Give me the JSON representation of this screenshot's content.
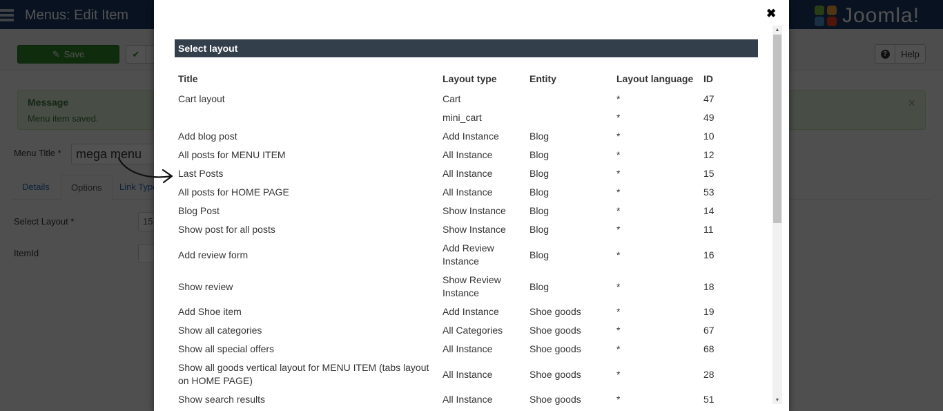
{
  "app": {
    "page_title": "Menus: Edit Item",
    "brand": "Joomla!"
  },
  "toolbar": {
    "save_label": "Save",
    "help_label": "Help"
  },
  "alert": {
    "heading": "Message",
    "message": "Menu item saved.",
    "close_glyph": "×"
  },
  "form": {
    "menu_title_label": "Menu Title *",
    "menu_title_value": "mega menu",
    "tabs": [
      {
        "label": "Details"
      },
      {
        "label": "Options",
        "active": true
      },
      {
        "label": "Link Type"
      }
    ],
    "select_layout_label": "Select Layout *",
    "select_layout_value": "15",
    "itemid_label": "ItemId",
    "itemid_value": ""
  },
  "modal": {
    "close_glyph": "✖",
    "section_title": "Select layout",
    "columns": [
      "Title",
      "Layout type",
      "Entity",
      "Layout language",
      "ID"
    ],
    "rows": [
      {
        "title": "Cart layout",
        "type": "Cart",
        "entity": "",
        "lang": "*",
        "id": "47"
      },
      {
        "title": "",
        "type": "mini_cart",
        "entity": "",
        "lang": "*",
        "id": "49"
      },
      {
        "title": "Add blog post",
        "type": "Add Instance",
        "entity": "Blog",
        "lang": "*",
        "id": "10"
      },
      {
        "title": "All posts for MENU ITEM",
        "type": "All Instance",
        "entity": "Blog",
        "lang": "*",
        "id": "12"
      },
      {
        "title": "Last Posts",
        "type": "All Instance",
        "entity": "Blog",
        "lang": "*",
        "id": "15"
      },
      {
        "title": "All posts for HOME PAGE",
        "type": "All Instance",
        "entity": "Blog",
        "lang": "*",
        "id": "53"
      },
      {
        "title": "Blog Post",
        "type": "Show Instance",
        "entity": "Blog",
        "lang": "*",
        "id": "14"
      },
      {
        "title": "Show post for all posts",
        "type": "Show Instance",
        "entity": "Blog",
        "lang": "*",
        "id": "11"
      },
      {
        "title": "Add review form",
        "type": "Add Review Instance",
        "entity": "Blog",
        "lang": "*",
        "id": "16"
      },
      {
        "title": "Show review",
        "type": "Show Review Instance",
        "entity": "Blog",
        "lang": "*",
        "id": "18"
      },
      {
        "title": "Add Shoe item",
        "type": "Add Instance",
        "entity": "Shoe goods",
        "lang": "*",
        "id": "19"
      },
      {
        "title": "Show all categories",
        "type": "All Categories",
        "entity": "Shoe goods",
        "lang": "*",
        "id": "67"
      },
      {
        "title": "Show all special offers",
        "type": "All Instance",
        "entity": "Shoe goods",
        "lang": "*",
        "id": "68"
      },
      {
        "title": "Show all goods vertical layout for MENU ITEM (tabs layout on HOME PAGE)",
        "type": "All Instance",
        "entity": "Shoe goods",
        "lang": "*",
        "id": "28"
      },
      {
        "title": "Show search results",
        "type": "All Instance",
        "entity": "Shoe goods",
        "lang": "*",
        "id": "51"
      }
    ]
  },
  "colors": {
    "topbar": "#1a3867",
    "save_green": "#2f8a2b",
    "section_header": "#343f4c",
    "alert_bg": "#dff0d8"
  }
}
